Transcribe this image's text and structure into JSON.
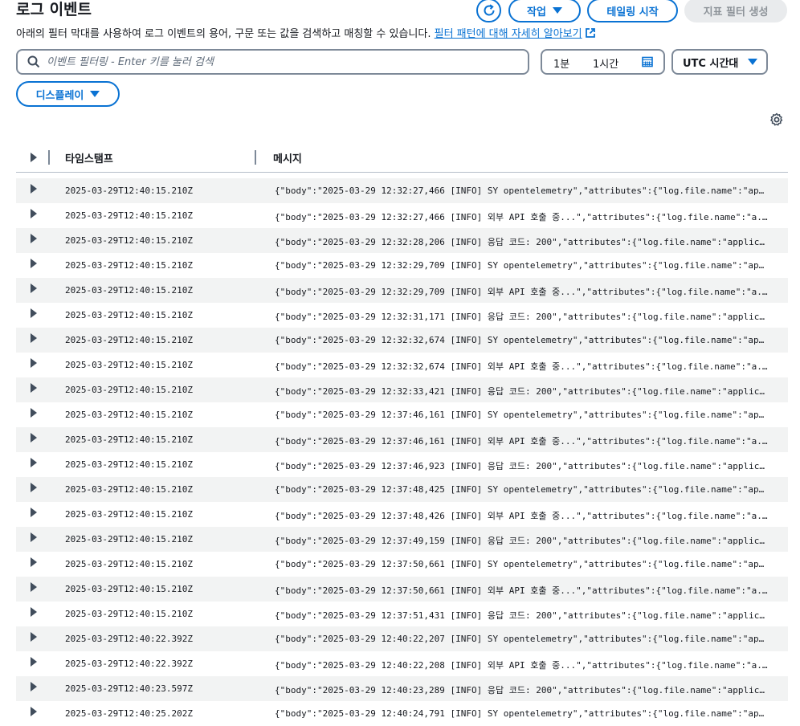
{
  "page": {
    "title": "로그 이벤트",
    "description": "아래의 필터 막대를 사용하여 로그 이벤트의 용어, 구문 또는 값을 검색하고 매칭할 수 있습니다.",
    "learn_more": "필터 패턴에 대해 자세히 알아보기"
  },
  "toolbar": {
    "refresh_icon": "refresh-icon",
    "action_label": "작업",
    "tail_label": "테일링 시작",
    "metric_filter_label": "지표 필터 생성",
    "display_label": "디스플레이"
  },
  "filter": {
    "placeholder": "이벤트 필터링 - Enter 키를 눌러 검색",
    "range_1": "1분",
    "range_2": "1시간",
    "timezone": "UTC 시간대"
  },
  "colors": {
    "accent": "#0972d3",
    "disabled_bg": "#e9ebed",
    "row_alt": "#f2f3f3"
  },
  "table": {
    "columns": [
      "타임스탬프",
      "메시지"
    ],
    "rows": [
      {
        "timestamp": "2025-03-29T12:40:15.210Z",
        "message": "{\"body\":\"2025-03-29 12:32:27,466 [INFO] SY opentelemetry\",\"attributes\":{\"log.file.name\":\"app..."
      },
      {
        "timestamp": "2025-03-29T12:40:15.210Z",
        "message": "{\"body\":\"2025-03-29 12:32:27,466 [INFO] 외부 API 호출 중...\",\"attributes\":{\"log.file.name\":\"a..."
      },
      {
        "timestamp": "2025-03-29T12:40:15.210Z",
        "message": "{\"body\":\"2025-03-29 12:32:28,206 [INFO] 응답 코드: 200\",\"attributes\":{\"log.file.name\":\"applic..."
      },
      {
        "timestamp": "2025-03-29T12:40:15.210Z",
        "message": "{\"body\":\"2025-03-29 12:32:29,709 [INFO] SY opentelemetry\",\"attributes\":{\"log.file.name\":\"app..."
      },
      {
        "timestamp": "2025-03-29T12:40:15.210Z",
        "message": "{\"body\":\"2025-03-29 12:32:29,709 [INFO] 외부 API 호출 중...\",\"attributes\":{\"log.file.name\":\"a..."
      },
      {
        "timestamp": "2025-03-29T12:40:15.210Z",
        "message": "{\"body\":\"2025-03-29 12:32:31,171 [INFO] 응답 코드: 200\",\"attributes\":{\"log.file.name\":\"applic..."
      },
      {
        "timestamp": "2025-03-29T12:40:15.210Z",
        "message": "{\"body\":\"2025-03-29 12:32:32,674 [INFO] SY opentelemetry\",\"attributes\":{\"log.file.name\":\"app..."
      },
      {
        "timestamp": "2025-03-29T12:40:15.210Z",
        "message": "{\"body\":\"2025-03-29 12:32:32,674 [INFO] 외부 API 호출 중...\",\"attributes\":{\"log.file.name\":\"a..."
      },
      {
        "timestamp": "2025-03-29T12:40:15.210Z",
        "message": "{\"body\":\"2025-03-29 12:32:33,421 [INFO] 응답 코드: 200\",\"attributes\":{\"log.file.name\":\"applic..."
      },
      {
        "timestamp": "2025-03-29T12:40:15.210Z",
        "message": "{\"body\":\"2025-03-29 12:37:46,161 [INFO] SY opentelemetry\",\"attributes\":{\"log.file.name\":\"app..."
      },
      {
        "timestamp": "2025-03-29T12:40:15.210Z",
        "message": "{\"body\":\"2025-03-29 12:37:46,161 [INFO] 외부 API 호출 중...\",\"attributes\":{\"log.file.name\":\"a..."
      },
      {
        "timestamp": "2025-03-29T12:40:15.210Z",
        "message": "{\"body\":\"2025-03-29 12:37:46,923 [INFO] 응답 코드: 200\",\"attributes\":{\"log.file.name\":\"applic..."
      },
      {
        "timestamp": "2025-03-29T12:40:15.210Z",
        "message": "{\"body\":\"2025-03-29 12:37:48,425 [INFO] SY opentelemetry\",\"attributes\":{\"log.file.name\":\"app..."
      },
      {
        "timestamp": "2025-03-29T12:40:15.210Z",
        "message": "{\"body\":\"2025-03-29 12:37:48,426 [INFO] 외부 API 호출 중...\",\"attributes\":{\"log.file.name\":\"a..."
      },
      {
        "timestamp": "2025-03-29T12:40:15.210Z",
        "message": "{\"body\":\"2025-03-29 12:37:49,159 [INFO] 응답 코드: 200\",\"attributes\":{\"log.file.name\":\"applic..."
      },
      {
        "timestamp": "2025-03-29T12:40:15.210Z",
        "message": "{\"body\":\"2025-03-29 12:37:50,661 [INFO] SY opentelemetry\",\"attributes\":{\"log.file.name\":\"app..."
      },
      {
        "timestamp": "2025-03-29T12:40:15.210Z",
        "message": "{\"body\":\"2025-03-29 12:37:50,661 [INFO] 외부 API 호출 중...\",\"attributes\":{\"log.file.name\":\"a..."
      },
      {
        "timestamp": "2025-03-29T12:40:15.210Z",
        "message": "{\"body\":\"2025-03-29 12:37:51,431 [INFO] 응답 코드: 200\",\"attributes\":{\"log.file.name\":\"applic..."
      },
      {
        "timestamp": "2025-03-29T12:40:22.392Z",
        "message": "{\"body\":\"2025-03-29 12:40:22,207 [INFO] SY opentelemetry\",\"attributes\":{\"log.file.name\":\"app..."
      },
      {
        "timestamp": "2025-03-29T12:40:22.392Z",
        "message": "{\"body\":\"2025-03-29 12:40:22,208 [INFO] 외부 API 호출 중...\",\"attributes\":{\"log.file.name\":\"a..."
      },
      {
        "timestamp": "2025-03-29T12:40:23.597Z",
        "message": "{\"body\":\"2025-03-29 12:40:23,289 [INFO] 응답 코드: 200\",\"attributes\":{\"log.file.name\":\"applic..."
      },
      {
        "timestamp": "2025-03-29T12:40:25.202Z",
        "message": "{\"body\":\"2025-03-29 12:40:24,791 [INFO] SY opentelemetry\",\"attributes\":{\"log.file.name\":\"app..."
      }
    ]
  }
}
